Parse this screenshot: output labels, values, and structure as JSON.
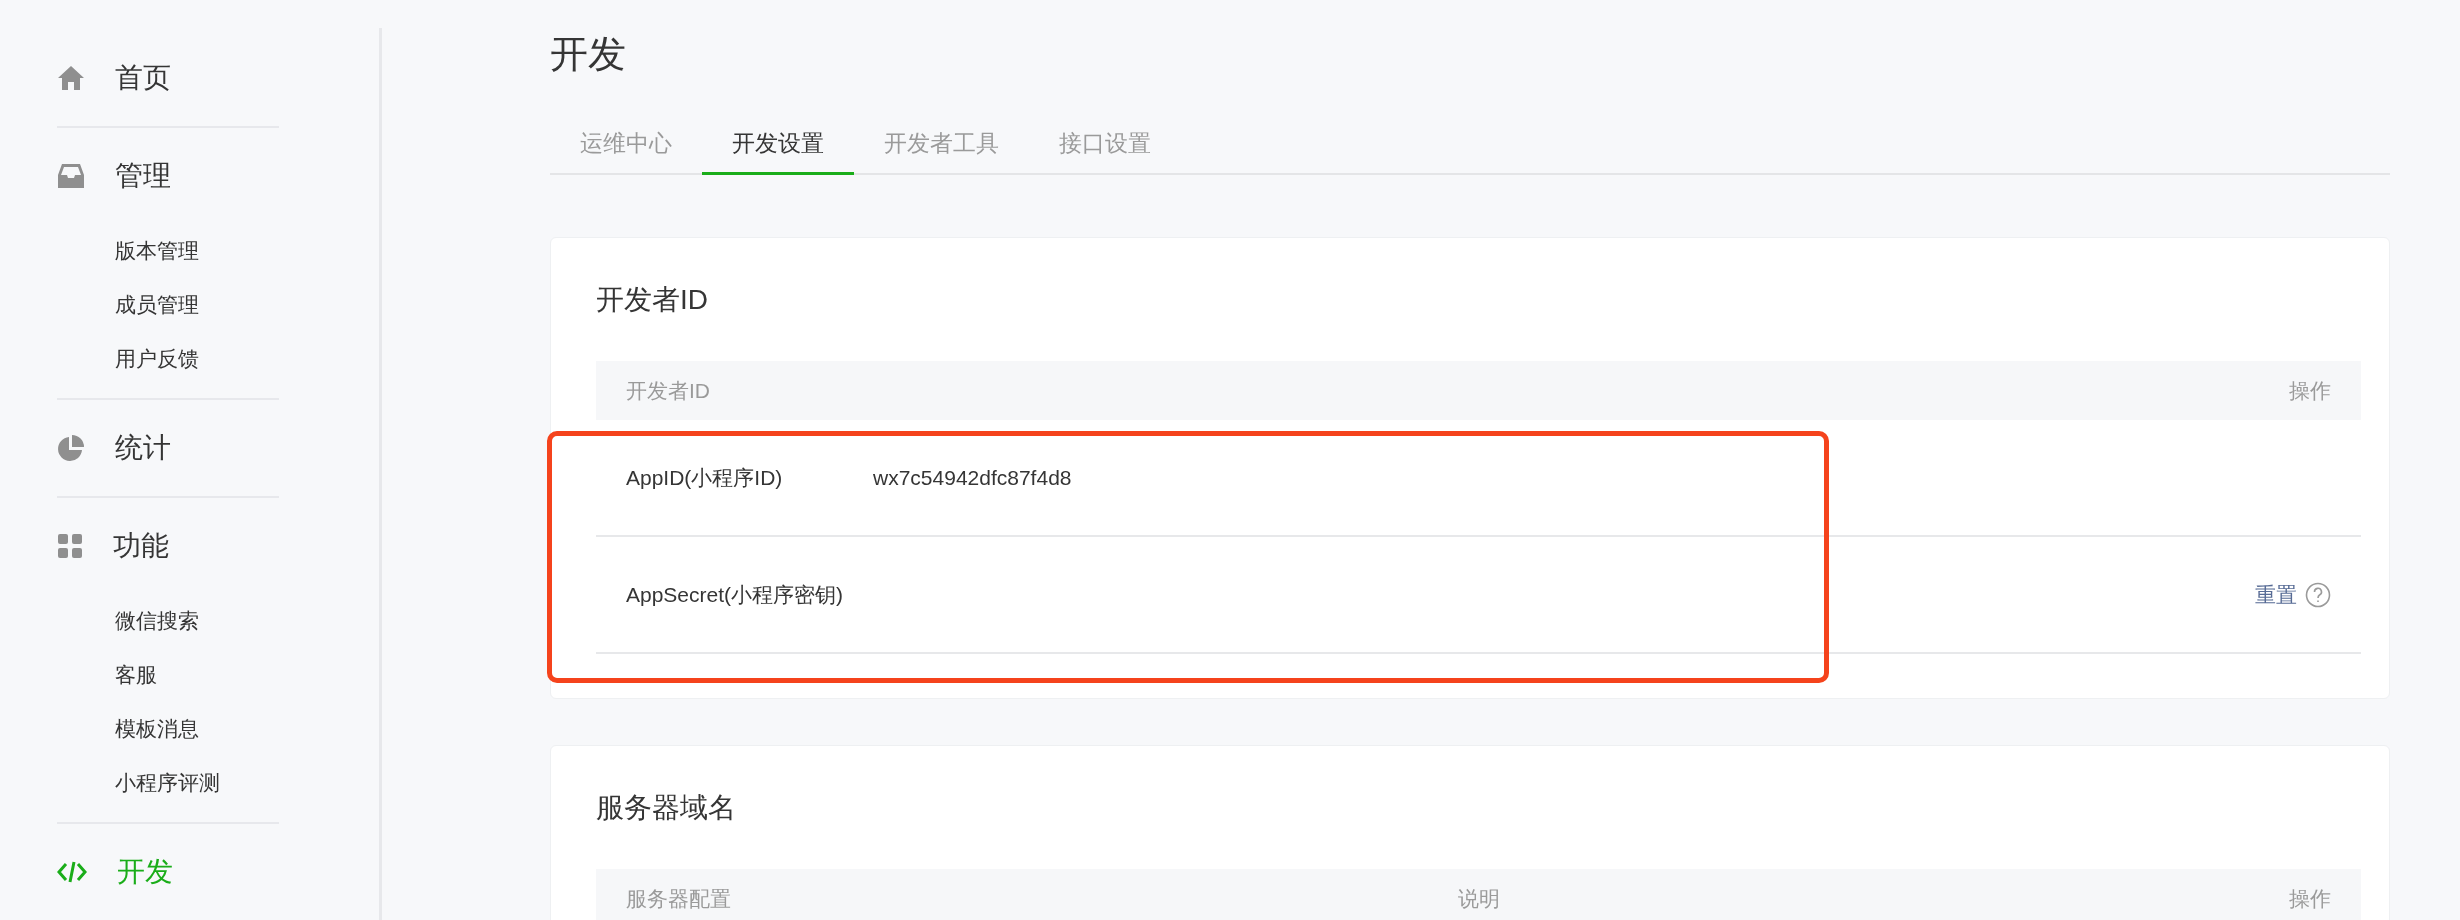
{
  "sidebar": {
    "sections": [
      {
        "label": "首页",
        "selected": false
      },
      {
        "label": "管理",
        "selected": false,
        "children": [
          {
            "label": "版本管理",
            "selected": false
          },
          {
            "label": "成员管理",
            "selected": false
          },
          {
            "label": "用户反馈",
            "selected": false
          }
        ]
      },
      {
        "label": "统计",
        "selected": false
      },
      {
        "label": "功能",
        "selected": false,
        "children": [
          {
            "label": "微信搜索",
            "selected": false
          },
          {
            "label": "客服",
            "selected": false
          },
          {
            "label": "模板消息",
            "selected": false
          },
          {
            "label": "小程序评测",
            "selected": false
          }
        ]
      },
      {
        "label": "开发",
        "selected": true
      }
    ]
  },
  "page": {
    "title": "开发"
  },
  "tabs": [
    {
      "label": "运维中心",
      "selected": false
    },
    {
      "label": "开发设置",
      "selected": true
    },
    {
      "label": "开发者工具",
      "selected": false
    },
    {
      "label": "接口设置",
      "selected": false
    }
  ],
  "developer_id": {
    "title": "开发者ID",
    "columns": [
      "开发者ID",
      "操作"
    ],
    "rows": [
      {
        "label": "AppID(小程序ID)",
        "value": "wx7c54942dfc87f4d8"
      },
      {
        "label": "AppSecret(小程序密钥)",
        "action": "重置",
        "help": true
      }
    ]
  },
  "server_domain": {
    "title": "服务器域名",
    "columns": [
      "服务器配置",
      "说明",
      "操作"
    ]
  }
}
